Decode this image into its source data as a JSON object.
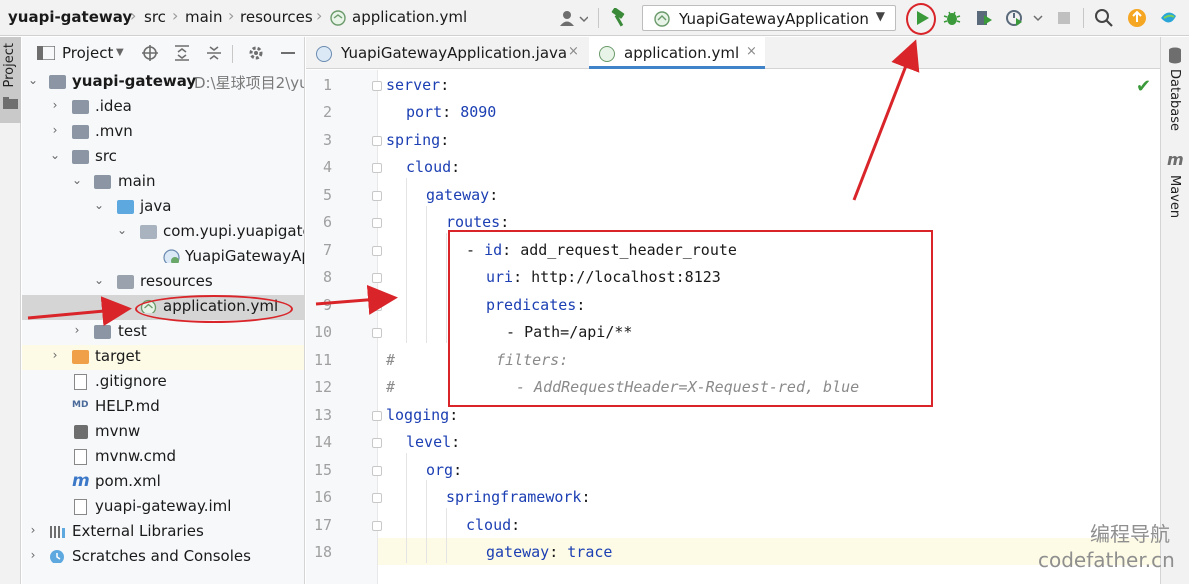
{
  "breadcrumb": {
    "project": "yuapi-gateway",
    "items": [
      "src",
      "main",
      "resources",
      "application.yml"
    ]
  },
  "toolbar": {
    "run_config": "YuapiGatewayApplication",
    "icons": [
      "user-icon",
      "build-hammer-icon",
      "run-icon",
      "debug-icon",
      "coverage-icon",
      "profile-icon",
      "stop-icon",
      "search-icon",
      "update-icon",
      "toolbox-icon"
    ]
  },
  "left_strip": {
    "project_tab": "Project"
  },
  "project_panel": {
    "title": "Project",
    "root": {
      "name": "yuapi-gateway",
      "path": "D:\\星球项目2\\yu"
    },
    "items": [
      {
        "label": ".idea"
      },
      {
        "label": ".mvn"
      },
      {
        "label": "src"
      },
      {
        "label": "main"
      },
      {
        "label": "java"
      },
      {
        "label": "com.yupi.yuapigate"
      },
      {
        "label": "YuapiGatewayAp"
      },
      {
        "label": "resources"
      },
      {
        "label": "application.yml"
      },
      {
        "label": "test"
      },
      {
        "label": "target"
      },
      {
        "label": ".gitignore"
      },
      {
        "label": "HELP.md"
      },
      {
        "label": "mvnw"
      },
      {
        "label": "mvnw.cmd"
      },
      {
        "label": "pom.xml"
      },
      {
        "label": "yuapi-gateway.iml"
      },
      {
        "label": "External Libraries"
      },
      {
        "label": "Scratches and Consoles"
      }
    ]
  },
  "tabs": [
    {
      "label": "YuapiGatewayApplication.java",
      "close": "×"
    },
    {
      "label": "application.yml",
      "close": "×"
    }
  ],
  "editor": {
    "line_numbers": [
      "1",
      "2",
      "3",
      "4",
      "5",
      "6",
      "7",
      "8",
      "9",
      "10",
      "11",
      "12",
      "13",
      "14",
      "15",
      "16",
      "17",
      "18"
    ],
    "lines": [
      {
        "key": "server",
        "punct": ":",
        "value": ""
      },
      {
        "key": "port",
        "punct": ": ",
        "value": "8090"
      },
      {
        "key": "spring",
        "punct": ":",
        "value": ""
      },
      {
        "key": "cloud",
        "punct": ":",
        "value": ""
      },
      {
        "key": "gateway",
        "punct": ":",
        "value": ""
      },
      {
        "key": "routes",
        "punct": ":",
        "value": ""
      },
      {
        "dash": "- ",
        "key": "id",
        "punct": ": ",
        "value": "add_request_header_route"
      },
      {
        "key": "uri",
        "punct": ": ",
        "value": "http://localhost:8123"
      },
      {
        "key": "predicates",
        "punct": ":",
        "value": ""
      },
      {
        "dash": "- ",
        "key": "",
        "punct": "",
        "value": "Path=/api/**"
      },
      {
        "hash": "#",
        "comment": "filters:"
      },
      {
        "hash": "#",
        "comment": "- AddRequestHeader=X-Request-red, blue"
      },
      {
        "key": "logging",
        "punct": ":",
        "value": ""
      },
      {
        "key": "level",
        "punct": ":",
        "value": ""
      },
      {
        "key": "org",
        "punct": ":",
        "value": ""
      },
      {
        "key": "springframework",
        "punct": ":",
        "value": ""
      },
      {
        "key": "cloud",
        "punct": ":",
        "value": ""
      },
      {
        "key": "gateway",
        "punct": ": ",
        "value": "trace"
      }
    ]
  },
  "right_strip": {
    "tabs": [
      "Database",
      "Maven"
    ]
  },
  "watermark": {
    "cn": "编程导航",
    "domain": "codefather.cn"
  },
  "colors": {
    "annotation": "#d9252a",
    "key": "#1c3fb3",
    "accent": "#4083c9",
    "run": "#3a9a3a"
  }
}
